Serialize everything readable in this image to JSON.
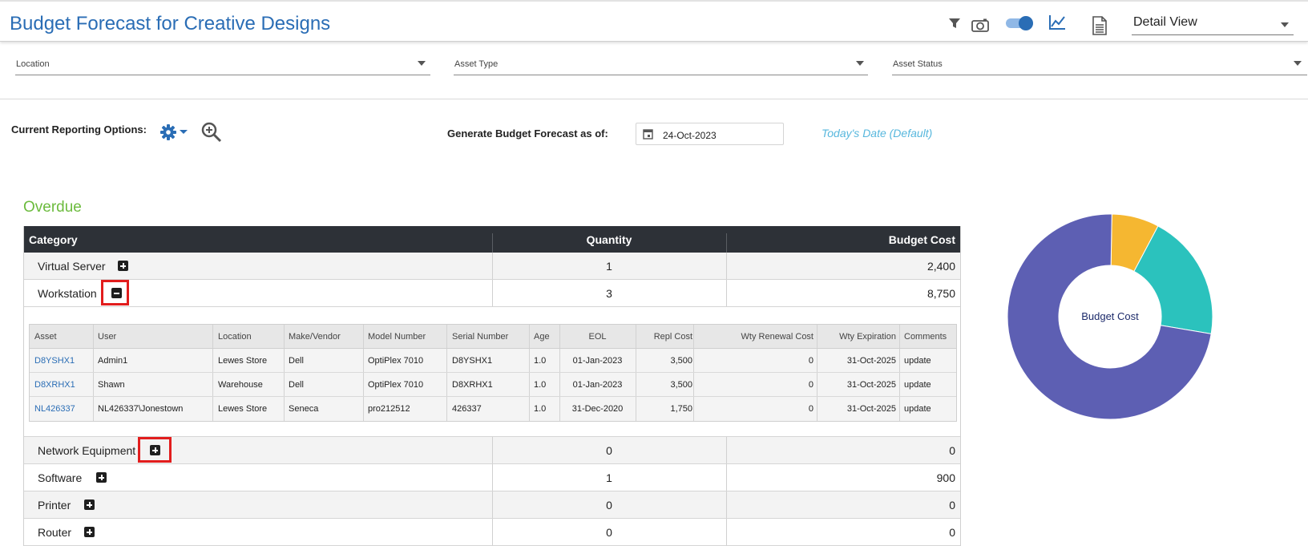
{
  "header": {
    "title": "Budget Forecast for Creative Designs",
    "view_select": "Detail View",
    "icons": [
      "filter-icon",
      "camera-icon",
      "toggle-switch",
      "chart-icon",
      "document-icon"
    ]
  },
  "filters": {
    "location": "Location",
    "asset_type": "Asset Type",
    "asset_status": "Asset Status"
  },
  "options": {
    "current_reporting_label": "Current Reporting Options:",
    "generate_label": "Generate Budget Forecast as of:",
    "date_value": "24-Oct-2023",
    "today_default": "Today's Date (Default)"
  },
  "section": {
    "title": "Overdue",
    "columns": {
      "category": "Category",
      "quantity": "Quantity",
      "budget_cost": "Budget Cost"
    },
    "rows": [
      {
        "category": "Virtual Server",
        "quantity": "1",
        "budget_cost": "2,400",
        "expanded": false
      },
      {
        "category": "Workstation",
        "quantity": "3",
        "budget_cost": "8,750",
        "expanded": true
      },
      {
        "category": "Network Equipment",
        "quantity": "0",
        "budget_cost": "0",
        "expanded": false
      },
      {
        "category": "Software",
        "quantity": "1",
        "budget_cost": "900",
        "expanded": false
      },
      {
        "category": "Printer",
        "quantity": "0",
        "budget_cost": "0",
        "expanded": false
      },
      {
        "category": "Router",
        "quantity": "0",
        "budget_cost": "0",
        "expanded": false
      }
    ]
  },
  "detail": {
    "columns": [
      "Asset",
      "User",
      "Location",
      "Make/Vendor",
      "Model Number",
      "Serial Number",
      "Age",
      "EOL",
      "Repl Cost",
      "Wty Renewal Cost",
      "Wty Expiration",
      "Comments"
    ],
    "rows": [
      [
        "D8YSHX1",
        "Admin1",
        "Lewes Store",
        "Dell",
        "OptiPlex 7010",
        "D8YSHX1",
        "1.0",
        "01-Jan-2023",
        "3,500",
        "0",
        "31-Oct-2025",
        "update"
      ],
      [
        "D8XRHX1",
        "Shawn",
        "Warehouse",
        "Dell",
        "OptiPlex 7010",
        "D8XRHX1",
        "1.0",
        "01-Jan-2023",
        "3,500",
        "0",
        "31-Oct-2025",
        "update"
      ],
      [
        "NL426337",
        "NL426337\\Jonestown",
        "Lewes Store",
        "Seneca",
        "pro212512",
        "426337",
        "1.0",
        "31-Dec-2020",
        "1,750",
        "0",
        "31-Oct-2025",
        "update"
      ]
    ]
  },
  "chart_data": {
    "type": "pie",
    "center_label": "Budget Cost",
    "slices": [
      {
        "category": "Virtual Server",
        "value": 2400,
        "color": "#2bc2bd"
      },
      {
        "category": "Workstation",
        "value": 8750,
        "color": "#5d5fb3"
      },
      {
        "category": "Software",
        "value": 900,
        "color": "#f5b731"
      }
    ]
  }
}
